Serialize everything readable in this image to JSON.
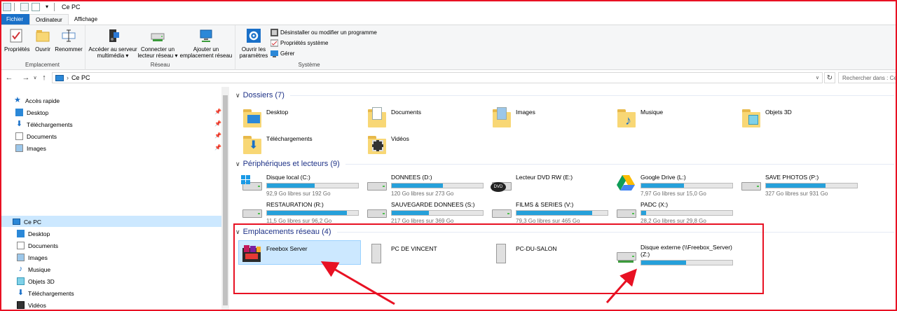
{
  "window": {
    "title": "Ce PC"
  },
  "tabs": [
    {
      "label": "Fichier"
    },
    {
      "label": "Ordinateur"
    },
    {
      "label": "Affichage"
    }
  ],
  "ribbon": {
    "emplacement": {
      "label": "Emplacement",
      "buttons": [
        {
          "label": "Propriétés",
          "icon": "properties-icon"
        },
        {
          "label": "Ouvrir",
          "icon": "open-folder-icon"
        },
        {
          "label": "Renommer",
          "icon": "rename-icon"
        }
      ]
    },
    "reseau": {
      "label": "Réseau",
      "buttons": [
        {
          "label": "Accéder au serveur multimédia ▾",
          "line1": "Accéder au serveur",
          "line2": "multimédia ▾",
          "icon": "media-server-icon"
        },
        {
          "label": "Connecter un lecteur réseau ▾",
          "line1": "Connecter un",
          "line2": "lecteur réseau ▾",
          "icon": "map-drive-icon"
        },
        {
          "label": "Ajouter un emplacement réseau",
          "line1": "Ajouter un",
          "line2": "emplacement réseau",
          "icon": "network-location-icon"
        }
      ]
    },
    "systeme": {
      "label": "Système",
      "open_settings": {
        "line1": "Ouvrir les",
        "line2": "paramètres",
        "icon": "settings-gear-icon"
      },
      "items": [
        {
          "label": "Désinstaller ou modifier un programme",
          "icon": "uninstall-icon"
        },
        {
          "label": "Propriétés système",
          "icon": "system-properties-icon"
        },
        {
          "label": "Gérer",
          "icon": "manage-icon"
        }
      ]
    }
  },
  "address": {
    "path": "Ce PC",
    "search_placeholder": "Rechercher dans : Ce PC"
  },
  "navpane": {
    "quick_access": "Accès rapide",
    "quick_items": [
      {
        "label": "Desktop"
      },
      {
        "label": "Téléchargements"
      },
      {
        "label": "Documents"
      },
      {
        "label": "Images"
      }
    ],
    "this_pc": "Ce PC",
    "pc_items": [
      {
        "label": "Desktop"
      },
      {
        "label": "Documents"
      },
      {
        "label": "Images"
      },
      {
        "label": "Musique"
      },
      {
        "label": "Objets 3D"
      },
      {
        "label": "Téléchargements"
      },
      {
        "label": "Vidéos"
      }
    ]
  },
  "folders": {
    "title": "Dossiers (7)",
    "items": [
      {
        "label": "Desktop"
      },
      {
        "label": "Documents"
      },
      {
        "label": "Images"
      },
      {
        "label": "Musique"
      },
      {
        "label": "Objets 3D"
      },
      {
        "label": "Téléchargements"
      },
      {
        "label": "Vidéos"
      }
    ]
  },
  "drives": {
    "title": "Périphériques et lecteurs (9)",
    "items": [
      {
        "name": "Disque local (C:)",
        "free": "92,9 Go libres sur 192 Go",
        "used": 0.52
      },
      {
        "name": "DONNEES (D:)",
        "free": "120 Go libres sur 273 Go",
        "used": 0.56
      },
      {
        "name": "Lecteur DVD RW (E:)",
        "free": "",
        "used": null
      },
      {
        "name": "Google Drive (L:)",
        "free": "7,97 Go libres sur 15,0 Go",
        "used": 0.47
      },
      {
        "name": "SAVE PHOTOS (P:)",
        "free": "327 Go libres sur 931 Go",
        "used": 0.65
      },
      {
        "name": "RESTAURATION (R:)",
        "free": "11,5 Go libres sur 96,2 Go",
        "used": 0.88
      },
      {
        "name": "SAUVEGARDE DONNEES (S:)",
        "free": "217 Go libres sur 369 Go",
        "used": 0.41
      },
      {
        "name": "FILMS & SERIES (V:)",
        "free": "79,3 Go libres sur 465 Go",
        "used": 0.83
      },
      {
        "name": "PADC (X:)",
        "free": "28,2 Go libres sur 29,8 Go",
        "used": 0.05
      }
    ]
  },
  "network": {
    "title": "Emplacements réseau (4)",
    "items": [
      {
        "label": "Freebox Server"
      },
      {
        "label": "PC DE VINCENT"
      },
      {
        "label": "PC-DU-SALON"
      },
      {
        "label": "Disque externe (\\\\Freebox_Server) (Z:)",
        "used": 0.49
      }
    ]
  },
  "colors": {
    "accent": "#1a70c8",
    "bar": "#26a0da",
    "annotation": "#e81123",
    "section_title": "#1e3287"
  }
}
